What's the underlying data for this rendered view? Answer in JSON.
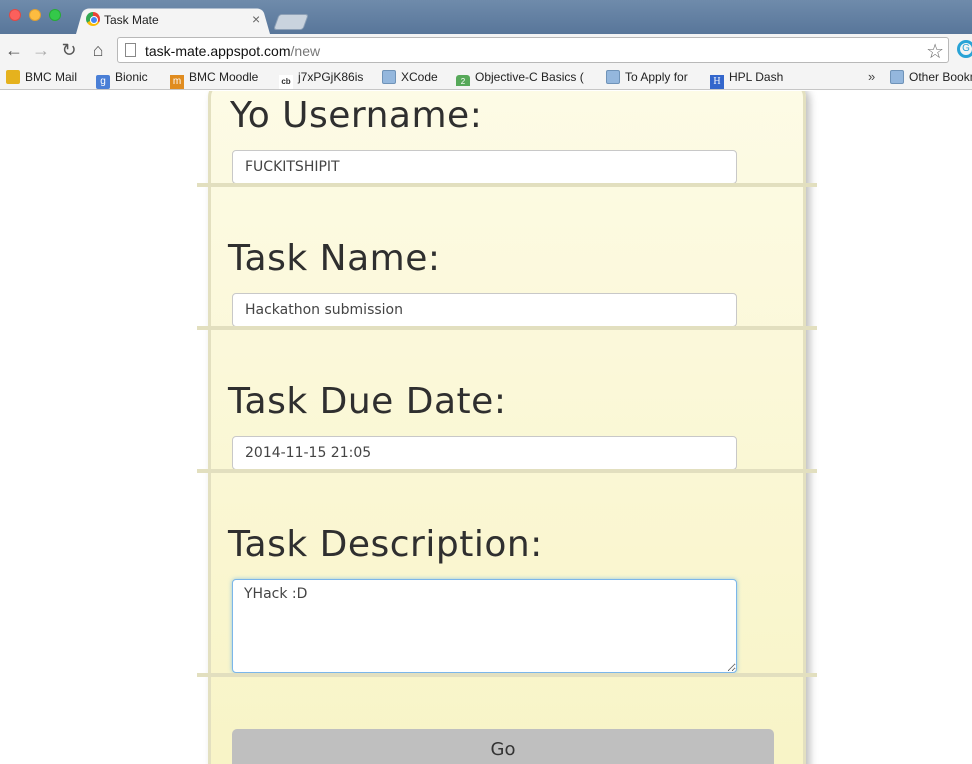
{
  "browser": {
    "tab_title": "Task Mate",
    "tab_close": "×",
    "url_host": "task-mate.appspot.com",
    "url_path": "/new",
    "bookmarks": [
      {
        "label": "BMC Mail",
        "icon": "fox-icon"
      },
      {
        "label": "Bionic",
        "icon": "google-icon"
      },
      {
        "label": "BMC Moodle",
        "icon": "moodle-icon"
      },
      {
        "label": "j7xPGjK86is",
        "icon": "cb-icon"
      },
      {
        "label": "XCode",
        "icon": "folder-icon"
      },
      {
        "label": "Objective-C Basics (",
        "icon": "hex-icon"
      },
      {
        "label": "To Apply for",
        "icon": "folder-icon"
      },
      {
        "label": "HPL Dash",
        "icon": "h-icon"
      },
      {
        "label": "Other Bookmarks",
        "icon": "folder-icon"
      }
    ],
    "bookmarks_more": "»"
  },
  "form": {
    "username_label": "Yo Username:",
    "username_value": "FUCKITSHIPIT",
    "task_name_label": "Task Name:",
    "task_name_value": "Hackathon submission",
    "due_date_label": "Task Due Date:",
    "due_date_value": "2014-11-15 21:05",
    "description_label": "Task Description:",
    "description_value": "YHack :D",
    "submit_label": "Go"
  },
  "colors": {
    "card_background": "#f8f4c6",
    "card_border": "#e3e0c0",
    "button_gray": "#bfbfbf",
    "focus_blue": "#7bb6ea"
  }
}
